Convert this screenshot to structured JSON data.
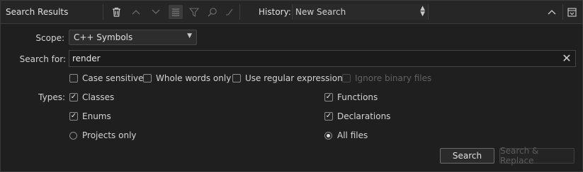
{
  "toolbar": {
    "title": "Search Results",
    "history_label": "History:",
    "history_value": "New Search"
  },
  "form": {
    "scope_label": "Scope:",
    "scope_value": "C++ Symbols",
    "search_label": "Search for:",
    "search_value": "render",
    "options": {
      "case_sensitive": "Case sensitive",
      "whole_words": "Whole words only",
      "regex": "Use regular expressions",
      "ignore_binary": "Ignore binary files"
    },
    "types_label": "Types:",
    "types": {
      "classes": "Classes",
      "functions": "Functions",
      "enums": "Enums",
      "declarations": "Declarations"
    },
    "scope_radios": {
      "projects_only": "Projects only",
      "all_files": "All files"
    }
  },
  "buttons": {
    "search": "Search",
    "search_replace": "Search & Replace"
  }
}
